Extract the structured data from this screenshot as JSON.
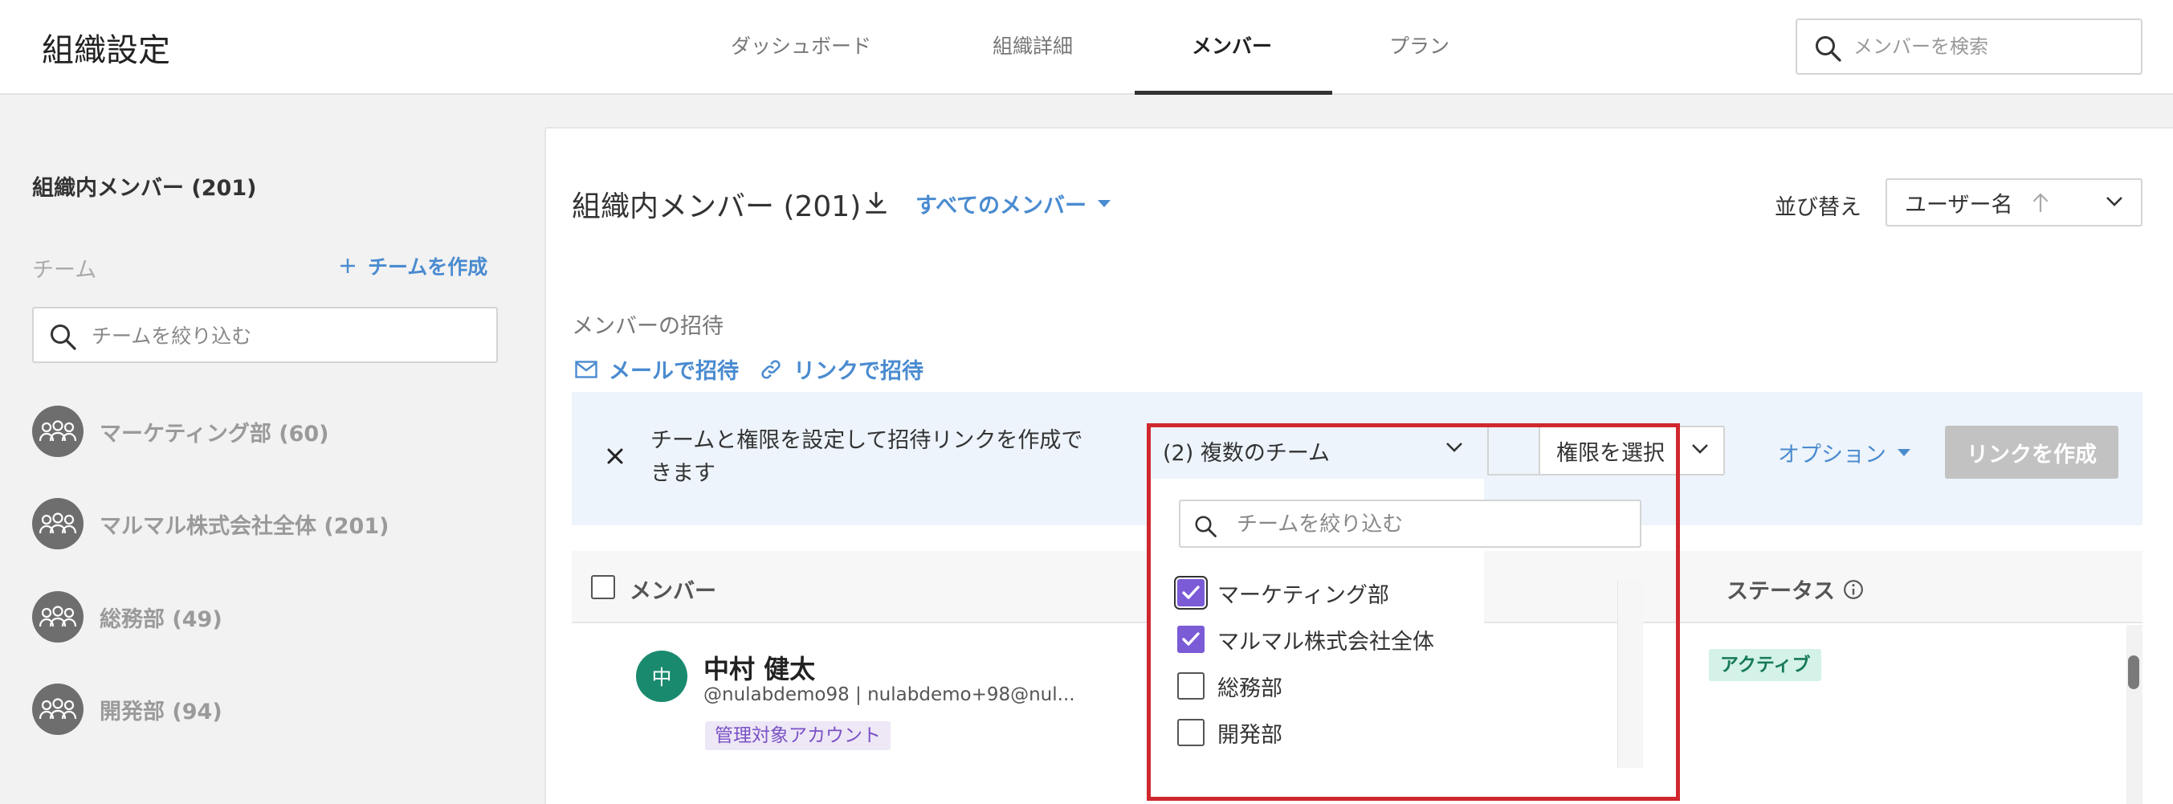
{
  "header": {
    "title": "組織設定",
    "tabs": [
      {
        "label": "ダッシュボード",
        "active": false
      },
      {
        "label": "組織詳細",
        "active": false
      },
      {
        "label": "メンバー",
        "active": true
      },
      {
        "label": "プラン",
        "active": false
      }
    ],
    "search_placeholder": "メンバーを検索"
  },
  "sidebar": {
    "title": "組織内メンバー (201)",
    "team_label": "チーム",
    "create_team_label": "チームを作成",
    "filter_placeholder": "チームを絞り込む",
    "teams": [
      {
        "name": "マーケティング部 (60)",
        "icon": "team-icon"
      },
      {
        "name": "マルマル株式会社全体 (201)",
        "icon": "team-icon"
      },
      {
        "name": "総務部 (49)",
        "icon": "team-icon"
      },
      {
        "name": "開発部 (94)",
        "icon": "team-icon"
      }
    ]
  },
  "main": {
    "title": "組織内メンバー (201)",
    "filter_dropdown_label": "すべてのメンバー",
    "sort_label": "並び替え",
    "sort_value": "ユーザー名",
    "invite": {
      "title": "メンバーの招待",
      "email_label": "メールで招待",
      "link_label": "リンクで招待",
      "description": "チームと権限を設定して招待リンクを作成できます",
      "team_select_value": "(2) 複数のチーム",
      "permission_select_value": "権限を選択",
      "options_label": "オプション",
      "create_link_label": "リンクを作成"
    },
    "team_dropdown": {
      "filter_placeholder": "チームを絞り込む",
      "options": [
        {
          "label": "マーケティング部",
          "checked": true,
          "focused": true
        },
        {
          "label": "マルマル株式会社全体",
          "checked": true,
          "focused": false
        },
        {
          "label": "総務部",
          "checked": false,
          "focused": false
        },
        {
          "label": "開発部",
          "checked": false,
          "focused": false
        }
      ]
    },
    "table": {
      "columns": {
        "member": "メンバー",
        "status": "ステータス"
      },
      "rows": [
        {
          "avatar_initial": "中",
          "name": "中村 健太",
          "sub": "@nulabdemo98 | nulabdemo+98@nul...",
          "badge": "管理対象アカウント",
          "status": "アクティブ"
        }
      ]
    }
  },
  "colors": {
    "accent": "#4a8bd0",
    "checkbox_checked": "#7b5bd6",
    "highlight": "#d0282e",
    "status_active_bg": "#d4f2e7"
  }
}
